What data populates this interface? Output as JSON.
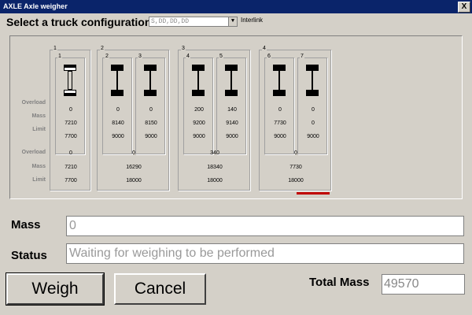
{
  "window": {
    "title": "AXLE Axle weigher",
    "close_label": "X"
  },
  "config": {
    "label": "Select a truck configuration:",
    "selected": "S,DD,DD,DD",
    "dropdown_arrow": "▼",
    "interlink_label": "Interlink"
  },
  "row_labels": {
    "overload": "Overload",
    "mass": "Mass",
    "limit": "Limit",
    "group_overload": "Overload",
    "group_mass": "Mass",
    "group_limit": "Limit"
  },
  "groups": [
    {
      "number": "1",
      "overload": "0",
      "mass": "7210",
      "limit": "7700",
      "axles": [
        {
          "number": "1",
          "type": "single",
          "overload": "0",
          "mass": "7210",
          "limit": "7700"
        }
      ]
    },
    {
      "number": "2",
      "overload": "0",
      "mass": "16290",
      "limit": "18000",
      "axles": [
        {
          "number": "2",
          "type": "dual",
          "overload": "0",
          "mass": "8140",
          "limit": "9000"
        },
        {
          "number": "3",
          "type": "dual",
          "overload": "0",
          "mass": "8150",
          "limit": "9000"
        }
      ]
    },
    {
      "number": "3",
      "overload": "340",
      "mass": "18340",
      "limit": "18000",
      "axles": [
        {
          "number": "4",
          "type": "dual",
          "overload": "200",
          "mass": "9200",
          "limit": "9000"
        },
        {
          "number": "5",
          "type": "dual",
          "overload": "140",
          "mass": "9140",
          "limit": "9000"
        }
      ]
    },
    {
      "number": "4",
      "overload": "0",
      "mass": "7730",
      "limit": "18000",
      "axles": [
        {
          "number": "6",
          "type": "dual",
          "overload": "0",
          "mass": "7730",
          "limit": "9000"
        },
        {
          "number": "7",
          "type": "dual",
          "overload": "0",
          "mass": "0",
          "limit": "9000"
        }
      ]
    }
  ],
  "mass_field": {
    "label": "Mass",
    "value": "0"
  },
  "status_field": {
    "label": "Status",
    "value": "Waiting for weighing to be performed"
  },
  "buttons": {
    "weigh": "Weigh",
    "cancel": "Cancel"
  },
  "total": {
    "label": "Total Mass",
    "value": "49570"
  },
  "colors": {
    "title_bar": "#0a246a",
    "window_bg": "#d4d0c8",
    "indicator_red": "#c00000"
  }
}
